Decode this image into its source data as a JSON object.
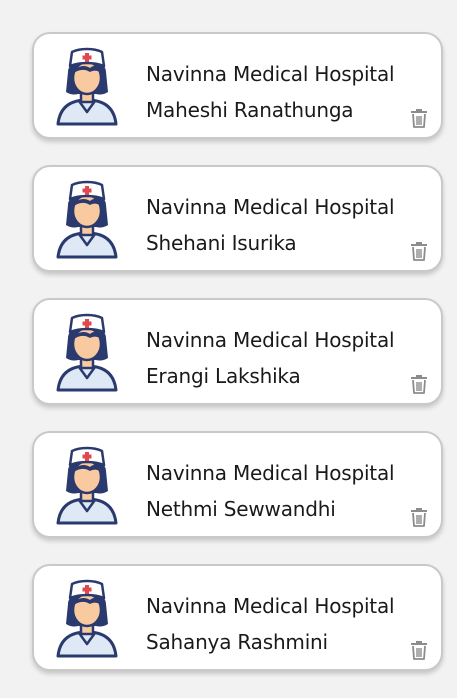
{
  "cards": [
    {
      "hospital": "Navinna Medical Hospital",
      "name": "Maheshi Ranathunga",
      "avatar_icon": "nurse-avatar-icon",
      "delete_icon": "trash-icon"
    },
    {
      "hospital": "Navinna Medical Hospital",
      "name": "Shehani Isurika",
      "avatar_icon": "nurse-avatar-icon",
      "delete_icon": "trash-icon"
    },
    {
      "hospital": "Navinna Medical Hospital",
      "name": "Erangi Lakshika",
      "avatar_icon": "nurse-avatar-icon",
      "delete_icon": "trash-icon"
    },
    {
      "hospital": "Navinna Medical Hospital",
      "name": "Nethmi Sewwandhi",
      "avatar_icon": "nurse-avatar-icon",
      "delete_icon": "trash-icon"
    },
    {
      "hospital": "Navinna Medical Hospital",
      "name": "Sahanya Rashmini",
      "avatar_icon": "nurse-avatar-icon",
      "delete_icon": "trash-icon"
    }
  ],
  "colors": {
    "background": "#f2f2f2",
    "card": "#ffffff",
    "card_border": "#c9c9c9",
    "text": "#1a1a1a",
    "avatar_outline": "#2a3a6e",
    "skin": "#f9c9a0",
    "hair": "#2a3a6e",
    "cap": "#ffffff",
    "cross": "#e0484f",
    "uniform": "#dfe9f6",
    "trash": "#8c8c8c"
  }
}
